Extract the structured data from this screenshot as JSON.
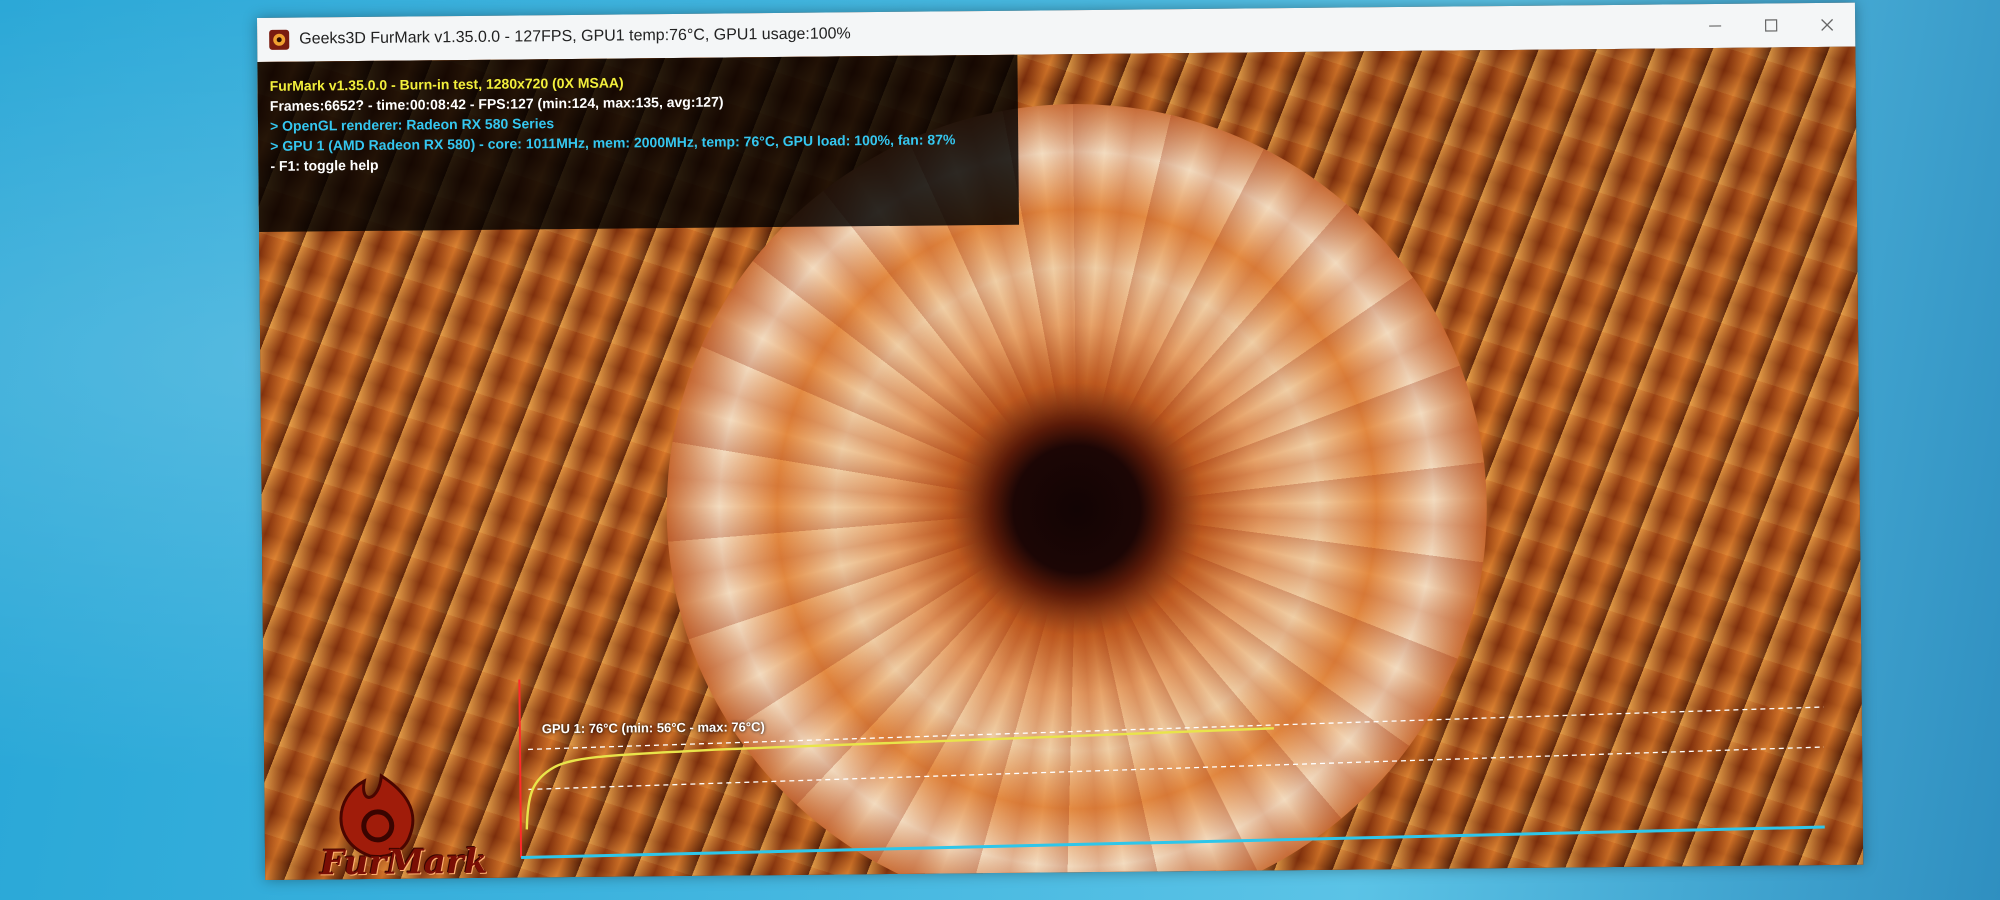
{
  "window": {
    "title": "Geeks3D FurMark v1.35.0.0 - 127FPS, GPU1 temp:76°C, GPU1 usage:100%",
    "icon": "furmark-app-icon"
  },
  "osd": {
    "lines": [
      {
        "text": "FurMark v1.35.0.0 - Burn-in test, 1280x720 (0X MSAA)",
        "color": "#f2ef3c"
      },
      {
        "text": "Frames:6652? - time:00:08:42 - FPS:127 (min:124, max:135, avg:127)",
        "color": "#ffffff"
      },
      {
        "text": "> OpenGL renderer: Radeon RX 580 Series",
        "color": "#35c7f0"
      },
      {
        "text": "> GPU 1 (AMD Radeon RX 580) - core: 1011MHz, mem: 2000MHz, temp: 76°C, GPU load: 100%, fan: 87%",
        "color": "#35c7f0"
      },
      {
        "text": "- F1: toggle help",
        "color": "#ffffff"
      }
    ]
  },
  "temperature_graph": {
    "label": "GPU 1: 76°C (min: 56°C - max: 76°C)",
    "current_c": 76,
    "min_c": 56,
    "max_c": 76,
    "line_color": "#e9e44a",
    "axis_color_x": "#2ec6ea",
    "axis_color_y": "#ff2a2a"
  },
  "logo": {
    "text": "FurMark"
  }
}
